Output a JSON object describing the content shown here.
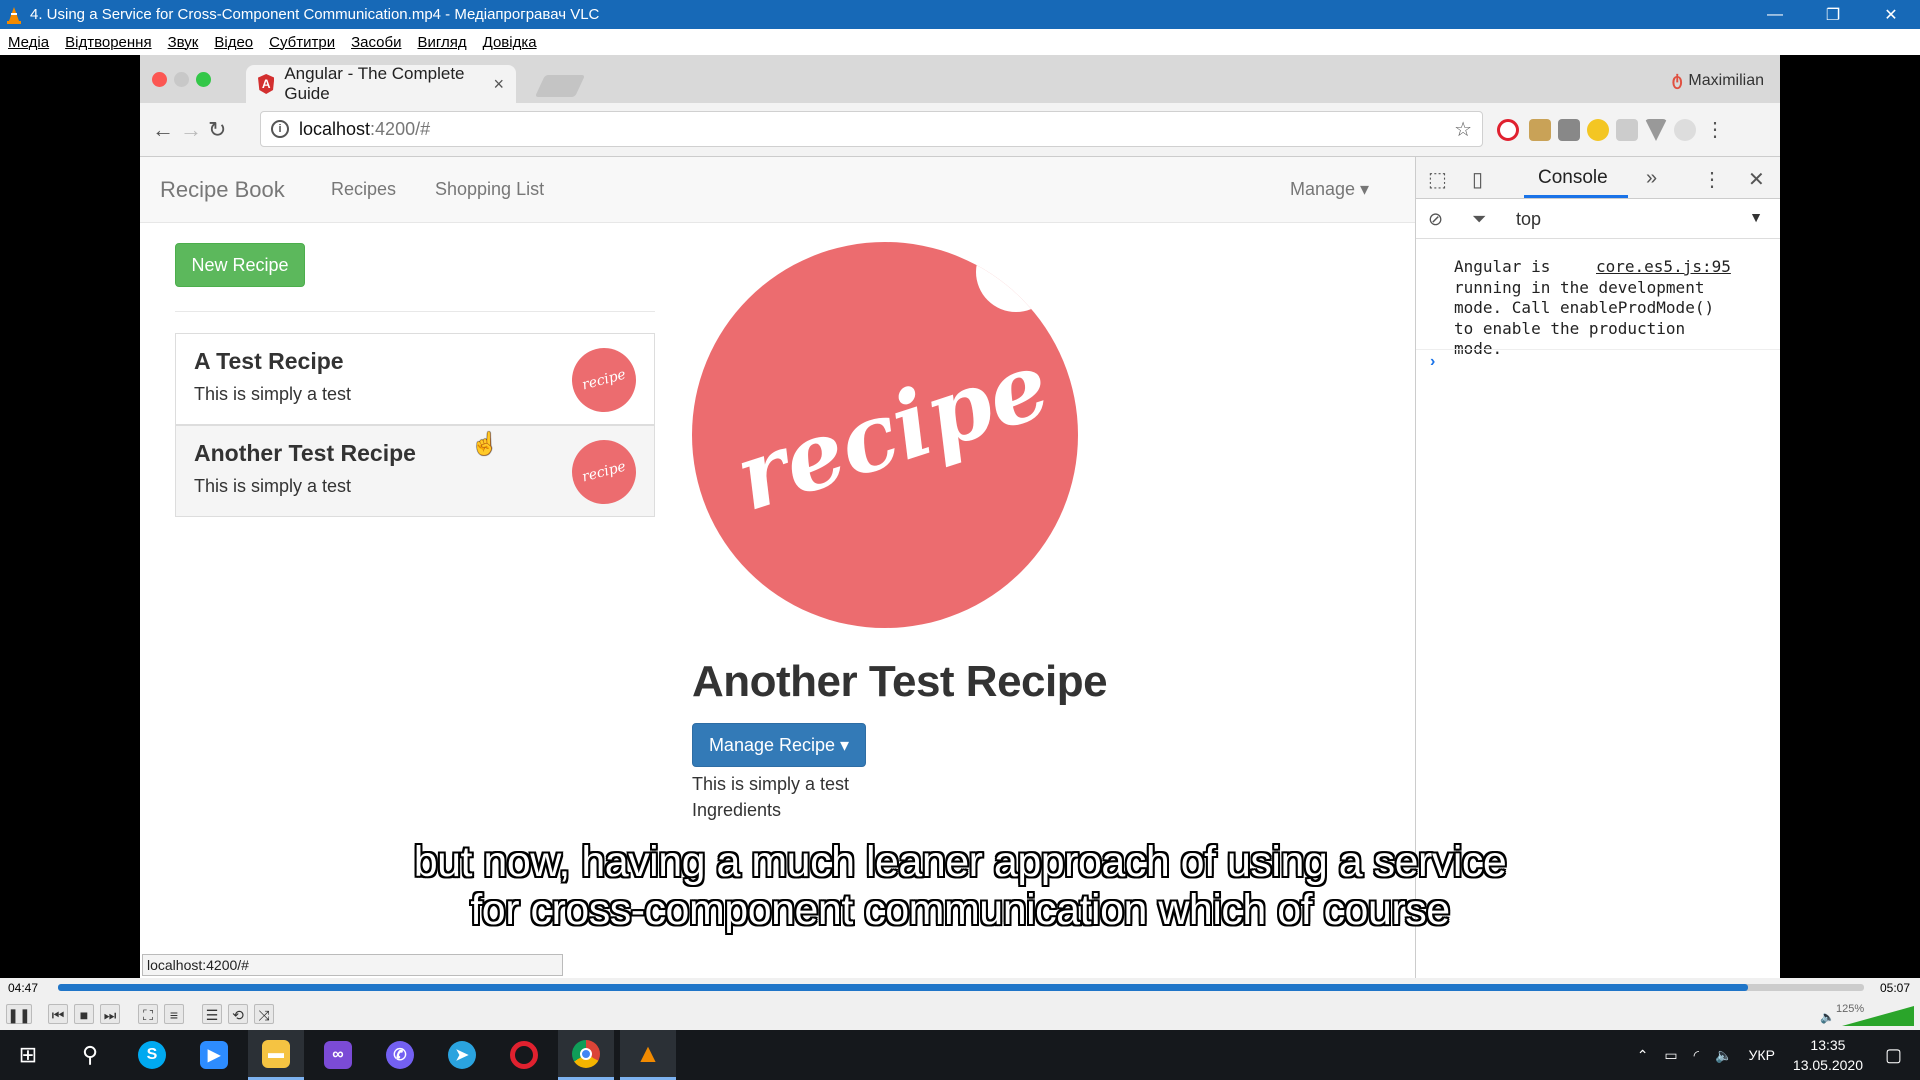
{
  "vlc": {
    "title": "4. Using a Service for Cross-Component Communication.mp4 - Медіапрогравач VLC",
    "minimize": "—",
    "restore": "❐",
    "close": "✕",
    "menu": [
      "Медіа",
      "Відтворення",
      "Звук",
      "Відео",
      "Субтитри",
      "Засоби",
      "Вигляд",
      "Довідка"
    ],
    "elapsed": "04:47",
    "total": "05:07",
    "progress": 0.936,
    "volume": "125%",
    "controls": [
      "pause-icon",
      "prev-icon",
      "stop-icon",
      "next-icon",
      "fullscreen-icon",
      "eq-icon",
      "playlist-icon",
      "loop-icon",
      "shuffle-icon"
    ]
  },
  "browser": {
    "tab_title": "Angular - The Complete Guide",
    "tab_close": "×",
    "profile": "Maximilian",
    "url_host": "localhost",
    "url_path": ":4200/#",
    "status_url": "localhost:4200/#"
  },
  "app": {
    "brand": "Recipe Book",
    "nav": [
      "Recipes",
      "Shopping List"
    ],
    "manage": "Manage ▾",
    "new_recipe": "New Recipe",
    "recipes": [
      {
        "name": "A Test Recipe",
        "description": "This is simply a test",
        "thumb": "recipe"
      },
      {
        "name": "Another Test Recipe",
        "description": "This is simply a test",
        "thumb": "recipe"
      }
    ],
    "image_word": "recipe",
    "detail_title": "Another Test Recipe",
    "manage_recipe": "Manage Recipe ▾",
    "detail_description": "This is simply a test",
    "ingredients_label": "Ingredients"
  },
  "devtools": {
    "tab": "Console",
    "context": "top",
    "message": "Angular is\nrunning in the development\nmode. Call enableProdMode()\nto enable the production\nmode.",
    "source": "core.es5.js:95",
    "prompt": "›"
  },
  "subtitles": [
    "but now, having a much leaner approach of using a service",
    "for cross-component communication which of course"
  ],
  "taskbar": {
    "lang": "УКР",
    "time": "13:35",
    "date": "13.05.2020"
  },
  "colors": {
    "vlc_titlebar": "#1769b7",
    "success_green": "#5cb85c",
    "primary_blue": "#337ab7",
    "recipe_red": "#ec6c6f",
    "taskbar": "#15181c"
  }
}
